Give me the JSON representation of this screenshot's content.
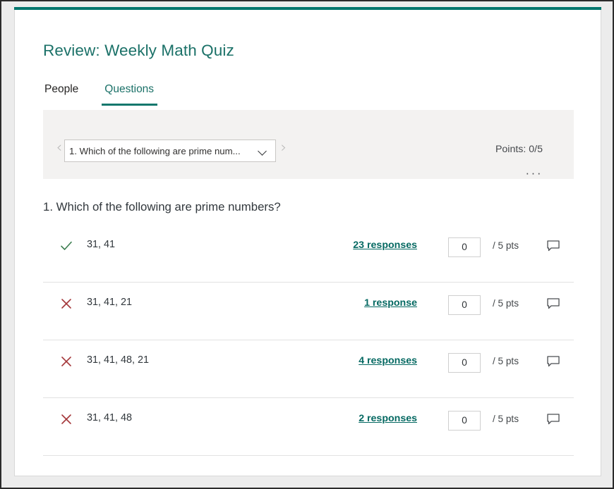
{
  "window": {
    "accent_color": "#00766d",
    "background": "#ececec"
  },
  "header": {
    "title": "Review: Weekly Math Quiz",
    "title_color": "#1b7168"
  },
  "tabs": [
    {
      "label": "People",
      "active": false
    },
    {
      "label": "Questions",
      "active": true
    }
  ],
  "question_nav": {
    "prev_arrow": "‹",
    "next_arrow": "›",
    "selected_question": "1. Which of the following are prime num...",
    "points_label": "Points: 0/5",
    "more_options": "···"
  },
  "question": {
    "heading": "1. Which of the following are prime numbers?",
    "max_points": "5"
  },
  "answers": [
    {
      "correct": true,
      "icon": "check-icon",
      "label": "31, 41",
      "responses": "23 responses",
      "score": "0",
      "points_suffix": "/ 5 pts",
      "comment": "comment-icon"
    },
    {
      "correct": false,
      "icon": "x-icon",
      "label": "31, 41, 21",
      "responses": "1 response",
      "score": "0",
      "points_suffix": "/ 5 pts",
      "comment": "comment-icon"
    },
    {
      "correct": false,
      "icon": "x-icon",
      "label": "31, 41, 48, 21",
      "responses": "4 responses",
      "score": "0",
      "points_suffix": "/ 5 pts",
      "comment": "comment-icon"
    },
    {
      "correct": false,
      "icon": "x-icon",
      "label": "31, 41, 48",
      "responses": "2 responses",
      "score": "0",
      "points_suffix": "/ 5 pts",
      "comment": "comment-icon"
    }
  ],
  "colors": {
    "link": "#056962",
    "check": "#3b7d4f",
    "cross": "#a4373a",
    "panel": "#f3f2f1"
  }
}
